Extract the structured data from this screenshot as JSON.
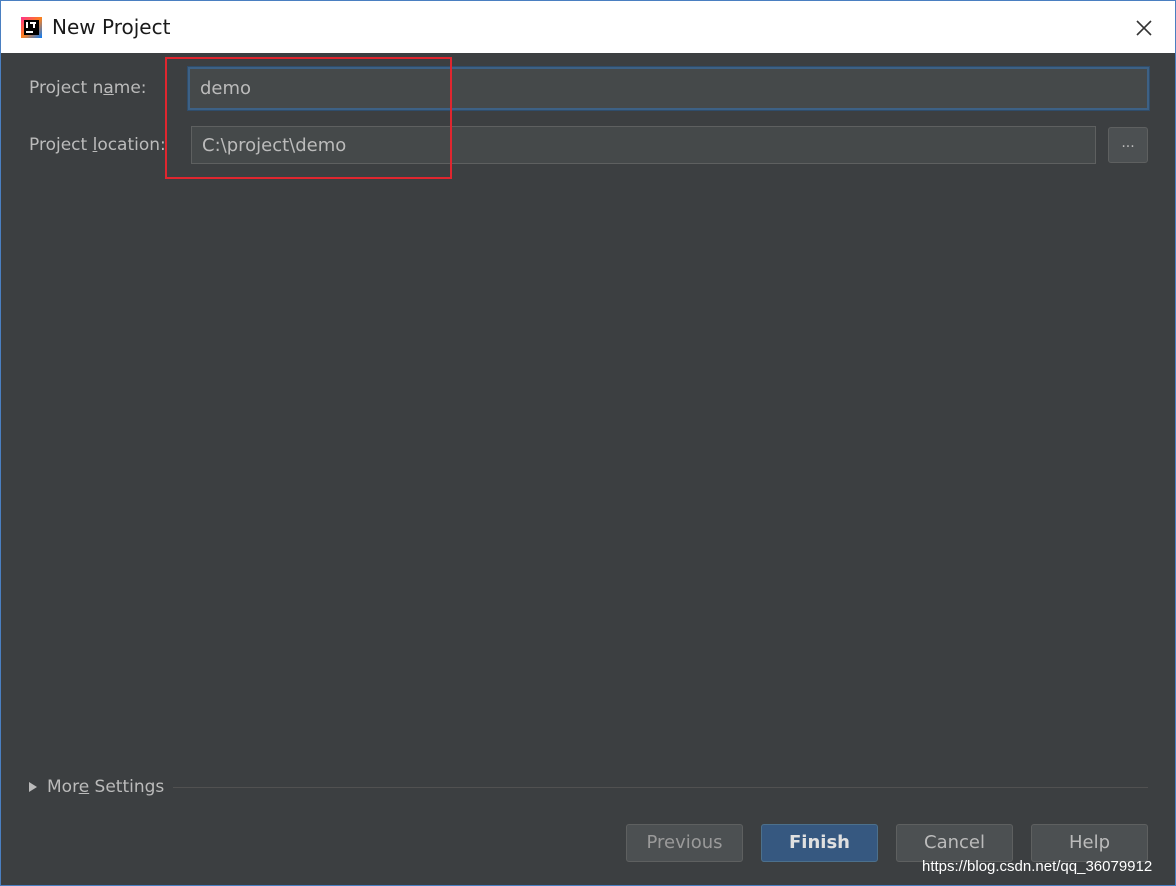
{
  "window": {
    "title": "New Project"
  },
  "form": {
    "name_label_pre": "Project n",
    "name_label_mnemonic": "a",
    "name_label_post": "me:",
    "name_value": "demo",
    "location_label_pre": "Project ",
    "location_label_mnemonic": "l",
    "location_label_post": "ocation:",
    "location_value": "C:\\project\\demo",
    "browse_label": "..."
  },
  "more_settings": {
    "label_pre": "Mor",
    "label_mnemonic": "e",
    "label_post": " Settings"
  },
  "buttons": {
    "previous": "Previous",
    "finish": "Finish",
    "cancel": "Cancel",
    "help": "Help"
  },
  "watermark": "https://blog.csdn.net/qq_36079912",
  "colors": {
    "background": "#3c3f41",
    "accent_border": "#3d6185",
    "finish_button": "#365880",
    "annotation": "#e0262f"
  },
  "icons": {
    "app": "intellij-idea-icon",
    "close": "close-icon",
    "expand": "triangle-right-icon"
  }
}
